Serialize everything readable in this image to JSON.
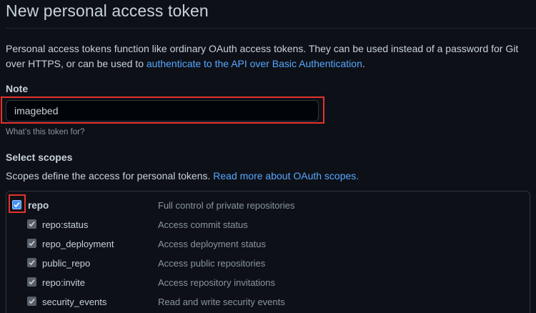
{
  "page": {
    "title": "New personal access token"
  },
  "intro": {
    "text_before": "Personal access tokens function like ordinary OAuth access tokens. They can be used instead of a password for Git over HTTPS, or can be used to ",
    "link_text": "authenticate to the API over Basic Authentication",
    "text_after": "."
  },
  "note": {
    "label": "Note",
    "value": "imagebed",
    "hint": "What’s this token for?"
  },
  "scopes": {
    "heading": "Select scopes",
    "description": "Scopes define the access for personal tokens. ",
    "link_text": "Read more about OAuth scopes.",
    "items": [
      {
        "name": "repo",
        "description": "Full control of private repositories",
        "checked": true
      },
      {
        "name": "repo:status",
        "description": "Access commit status",
        "checked": true
      },
      {
        "name": "repo_deployment",
        "description": "Access deployment status",
        "checked": true
      },
      {
        "name": "public_repo",
        "description": "Access public repositories",
        "checked": true
      },
      {
        "name": "repo:invite",
        "description": "Access repository invitations",
        "checked": true
      },
      {
        "name": "security_events",
        "description": "Read and write security events",
        "checked": true
      }
    ]
  },
  "colors": {
    "background": "#0d1117",
    "link": "#58a6ff",
    "checkbox_checked": "#4493f8",
    "checkbox_inherited": "#5a6069",
    "highlight_outline": "#e5322d"
  }
}
